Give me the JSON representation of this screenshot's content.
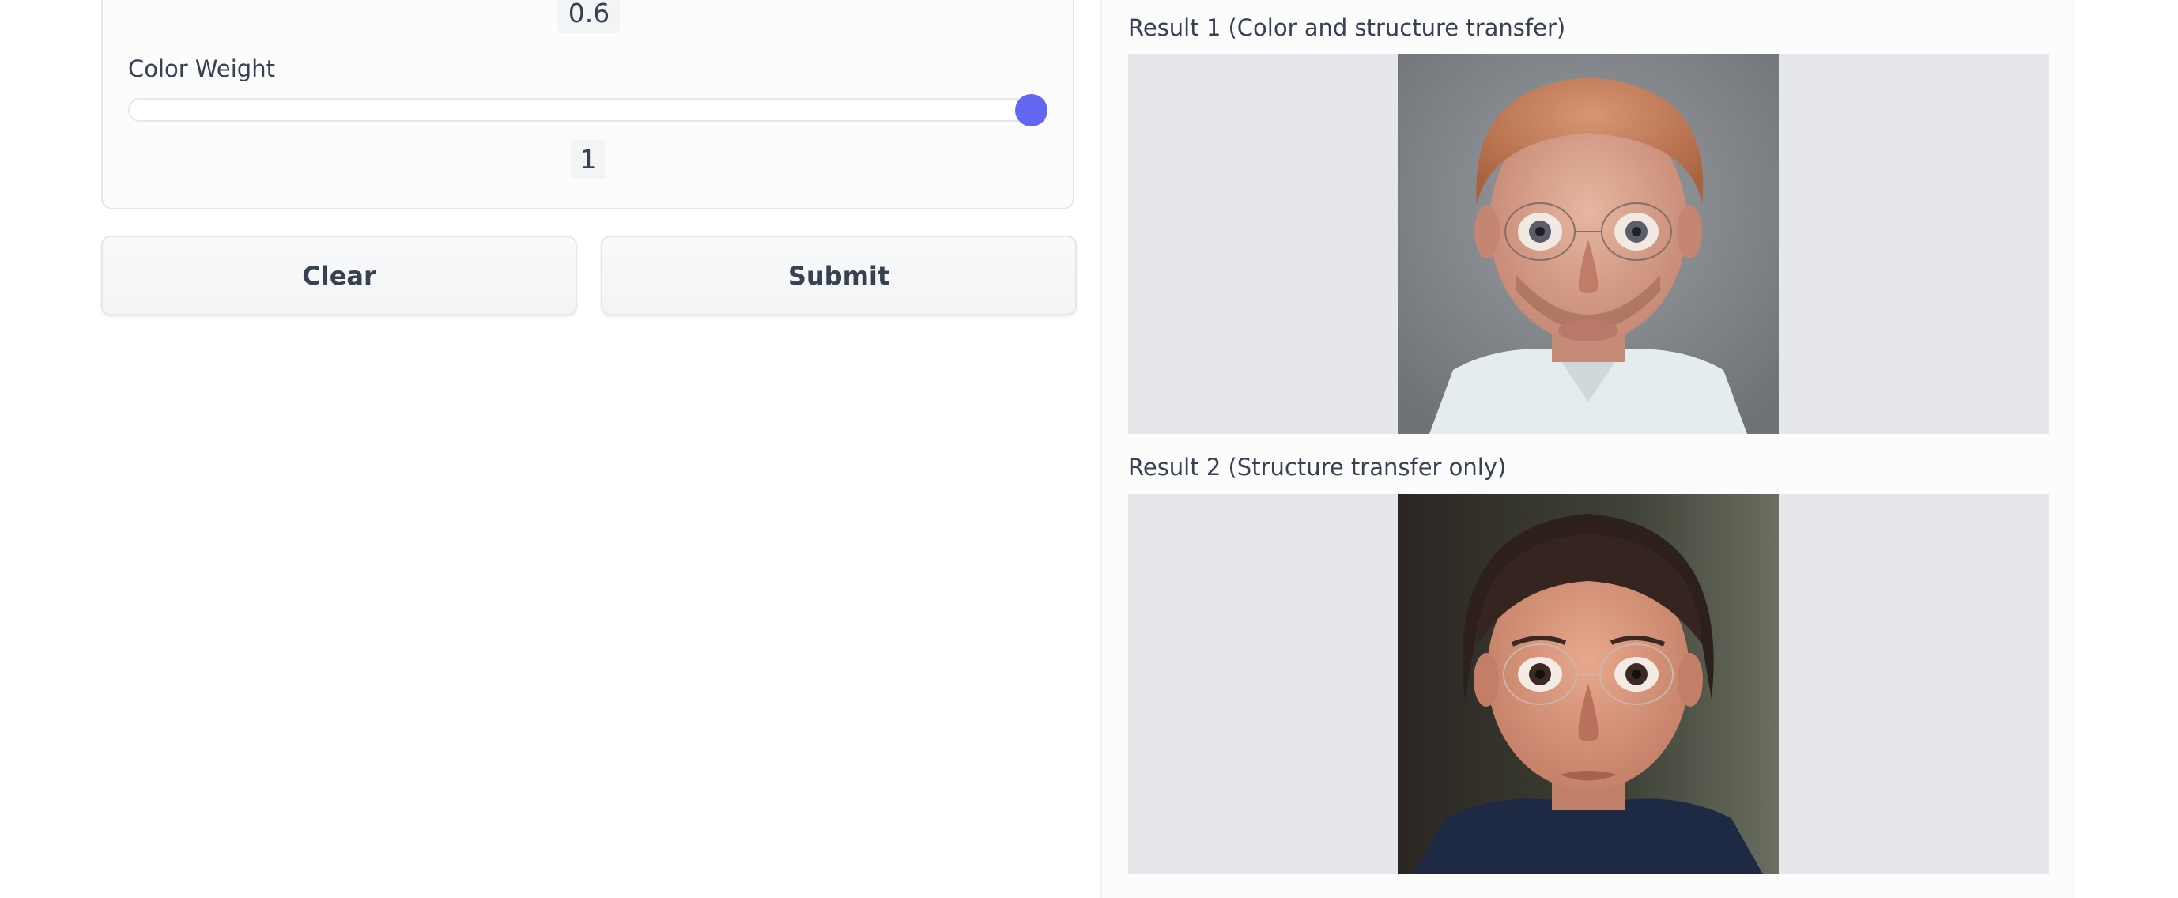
{
  "controls": {
    "previous_slider_value": "0.6",
    "color_weight": {
      "label": "Color Weight",
      "value": "1",
      "slider_fraction": 1.0
    },
    "buttons": {
      "clear_label": "Clear",
      "submit_label": "Submit"
    }
  },
  "results": {
    "result_1": {
      "label": "Result 1 (Color and structure transfer)"
    },
    "result_2": {
      "label": "Result 2 (Structure transfer only)"
    }
  },
  "colors": {
    "accent": "#6366f1",
    "panel_border": "#e5e7eb",
    "image_background": "#e5e7eb"
  }
}
